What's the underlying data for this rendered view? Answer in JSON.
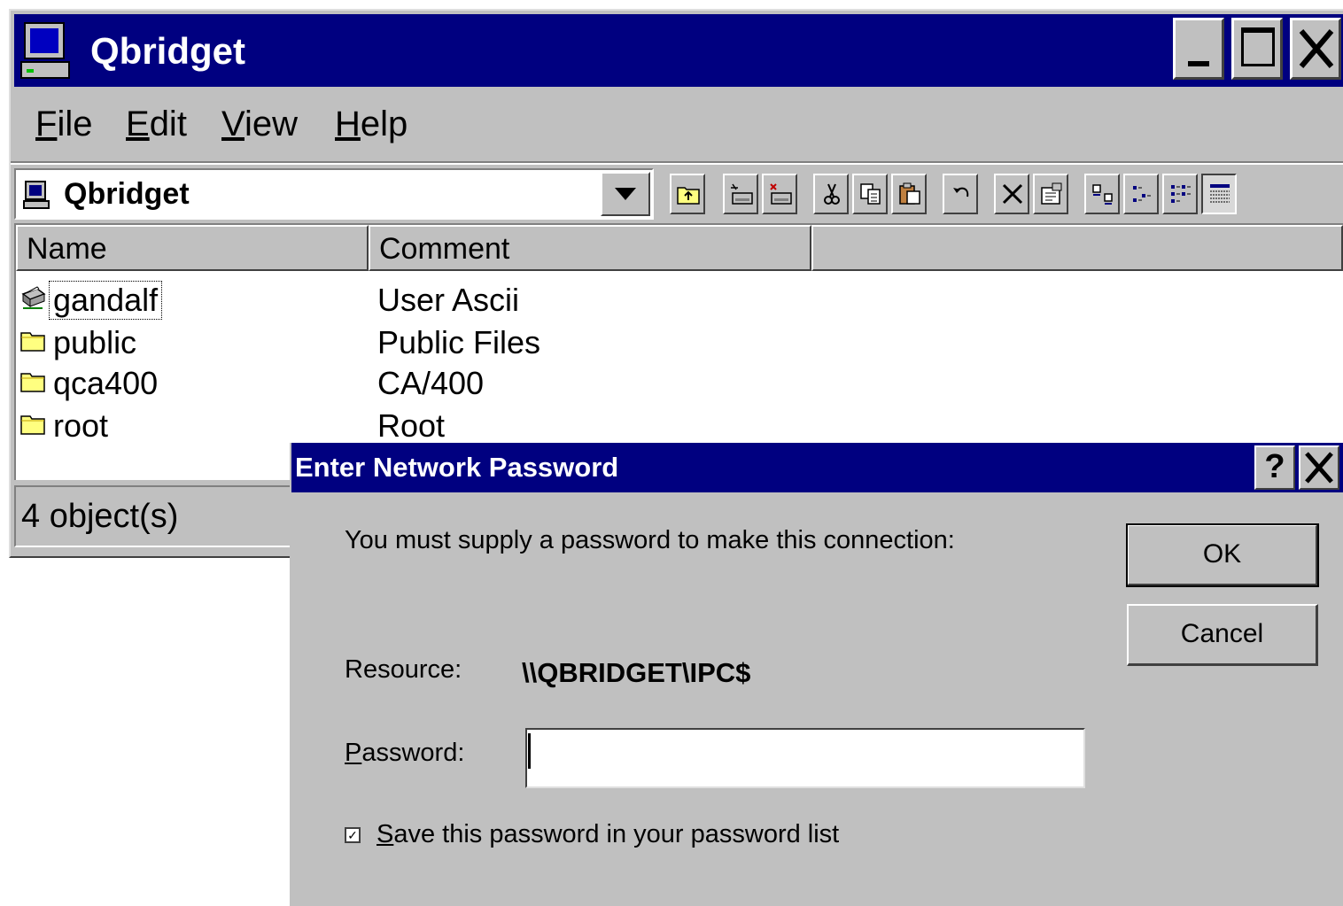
{
  "window": {
    "title": "Qbridget",
    "minimize_label": "_",
    "maximize_label": "□",
    "close_label": "X"
  },
  "menu": [
    {
      "first": "F",
      "rest": "ile"
    },
    {
      "first": "E",
      "rest": "dit"
    },
    {
      "first": "V",
      "rest": "iew"
    },
    {
      "first": "H",
      "rest": "elp"
    }
  ],
  "address": {
    "value": "Qbridget"
  },
  "toolbar": {
    "buttons": [
      "up-one-level",
      "map-network-drive",
      "disconnect-network-drive",
      "cut",
      "copy",
      "paste",
      "undo",
      "delete",
      "properties",
      "large-icons",
      "small-icons",
      "list",
      "details"
    ],
    "active": "details"
  },
  "list": {
    "columns": [
      "Name",
      "Comment"
    ],
    "rows": [
      {
        "name": "gandalf",
        "comment": "User Ascii",
        "icon": "network-printer-icon"
      },
      {
        "name": "public",
        "comment": "Public Files",
        "icon": "folder-icon"
      },
      {
        "name": "qca400",
        "comment": "CA/400",
        "icon": "folder-icon"
      },
      {
        "name": "root",
        "comment": "Root",
        "icon": "folder-icon"
      }
    ]
  },
  "status": {
    "text": "4 object(s)"
  },
  "dialog": {
    "title": "Enter Network Password",
    "help_label": "?",
    "close_label": "X",
    "message": "You must supply a password to make this connection:",
    "ok_label": "OK",
    "cancel_label": "Cancel",
    "resource_label": "Resource:",
    "resource_value": "\\\\QBRIDGET\\IPC$",
    "password_label_first": "P",
    "password_label_rest": "assword:",
    "password_value": "",
    "save_label_first": "S",
    "save_label_rest": "ave this password in your password list",
    "save_checked": true,
    "save_check_glyph": "✓"
  },
  "colors": {
    "titlebar": "#000080",
    "face": "#c0c0c0",
    "window": "#ffffff"
  }
}
